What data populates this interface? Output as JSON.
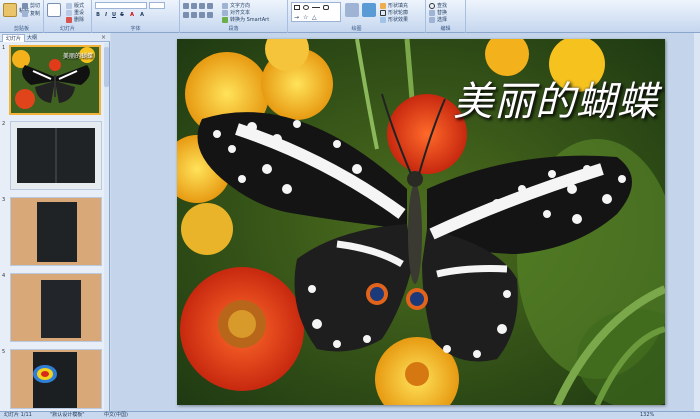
{
  "ribbon": {
    "groups": {
      "clipboard": "剪贴板",
      "slides": "幻灯片",
      "font": "字体",
      "paragraph": "段落",
      "drawing": "绘图",
      "editing": "编辑"
    },
    "buttons": {
      "cut": "剪切",
      "copy": "复制",
      "paste": "粘贴",
      "new_slide": "新建\n幻灯片",
      "layout": "版式",
      "reset": "重设",
      "delete": "删除",
      "text_direction": "文字方向",
      "align_text": "对齐文本",
      "smartart": "转换为 SmartArt",
      "arrange": "排列",
      "quick_styles": "快速样式",
      "shape_fill": "形状填充",
      "shape_outline": "形状轮廓",
      "shape_effects": "形状效果",
      "find": "查找",
      "replace": "替换",
      "select": "选择"
    },
    "font_name": "",
    "font_size": ""
  },
  "left_pane": {
    "tab_slides": "幻灯片",
    "tab_outline": "大纲",
    "close": "×",
    "thumbnails": [
      {
        "number": "1"
      },
      {
        "number": "2"
      },
      {
        "number": "3"
      },
      {
        "number": "4"
      },
      {
        "number": "5"
      }
    ],
    "thumb1_title": "美丽的蝴蝶"
  },
  "slide": {
    "title": "美丽的蝴蝶"
  },
  "status": {
    "slide_count": "幻灯片 1/11",
    "theme": "\"默认设计模板\"",
    "language": "中文(中国)",
    "zoom": "132%"
  },
  "colors": {
    "ribbon_bg": "#d6e3f5",
    "accent_selected": "#f2b33b",
    "status_bg": "#c8d8ee"
  }
}
